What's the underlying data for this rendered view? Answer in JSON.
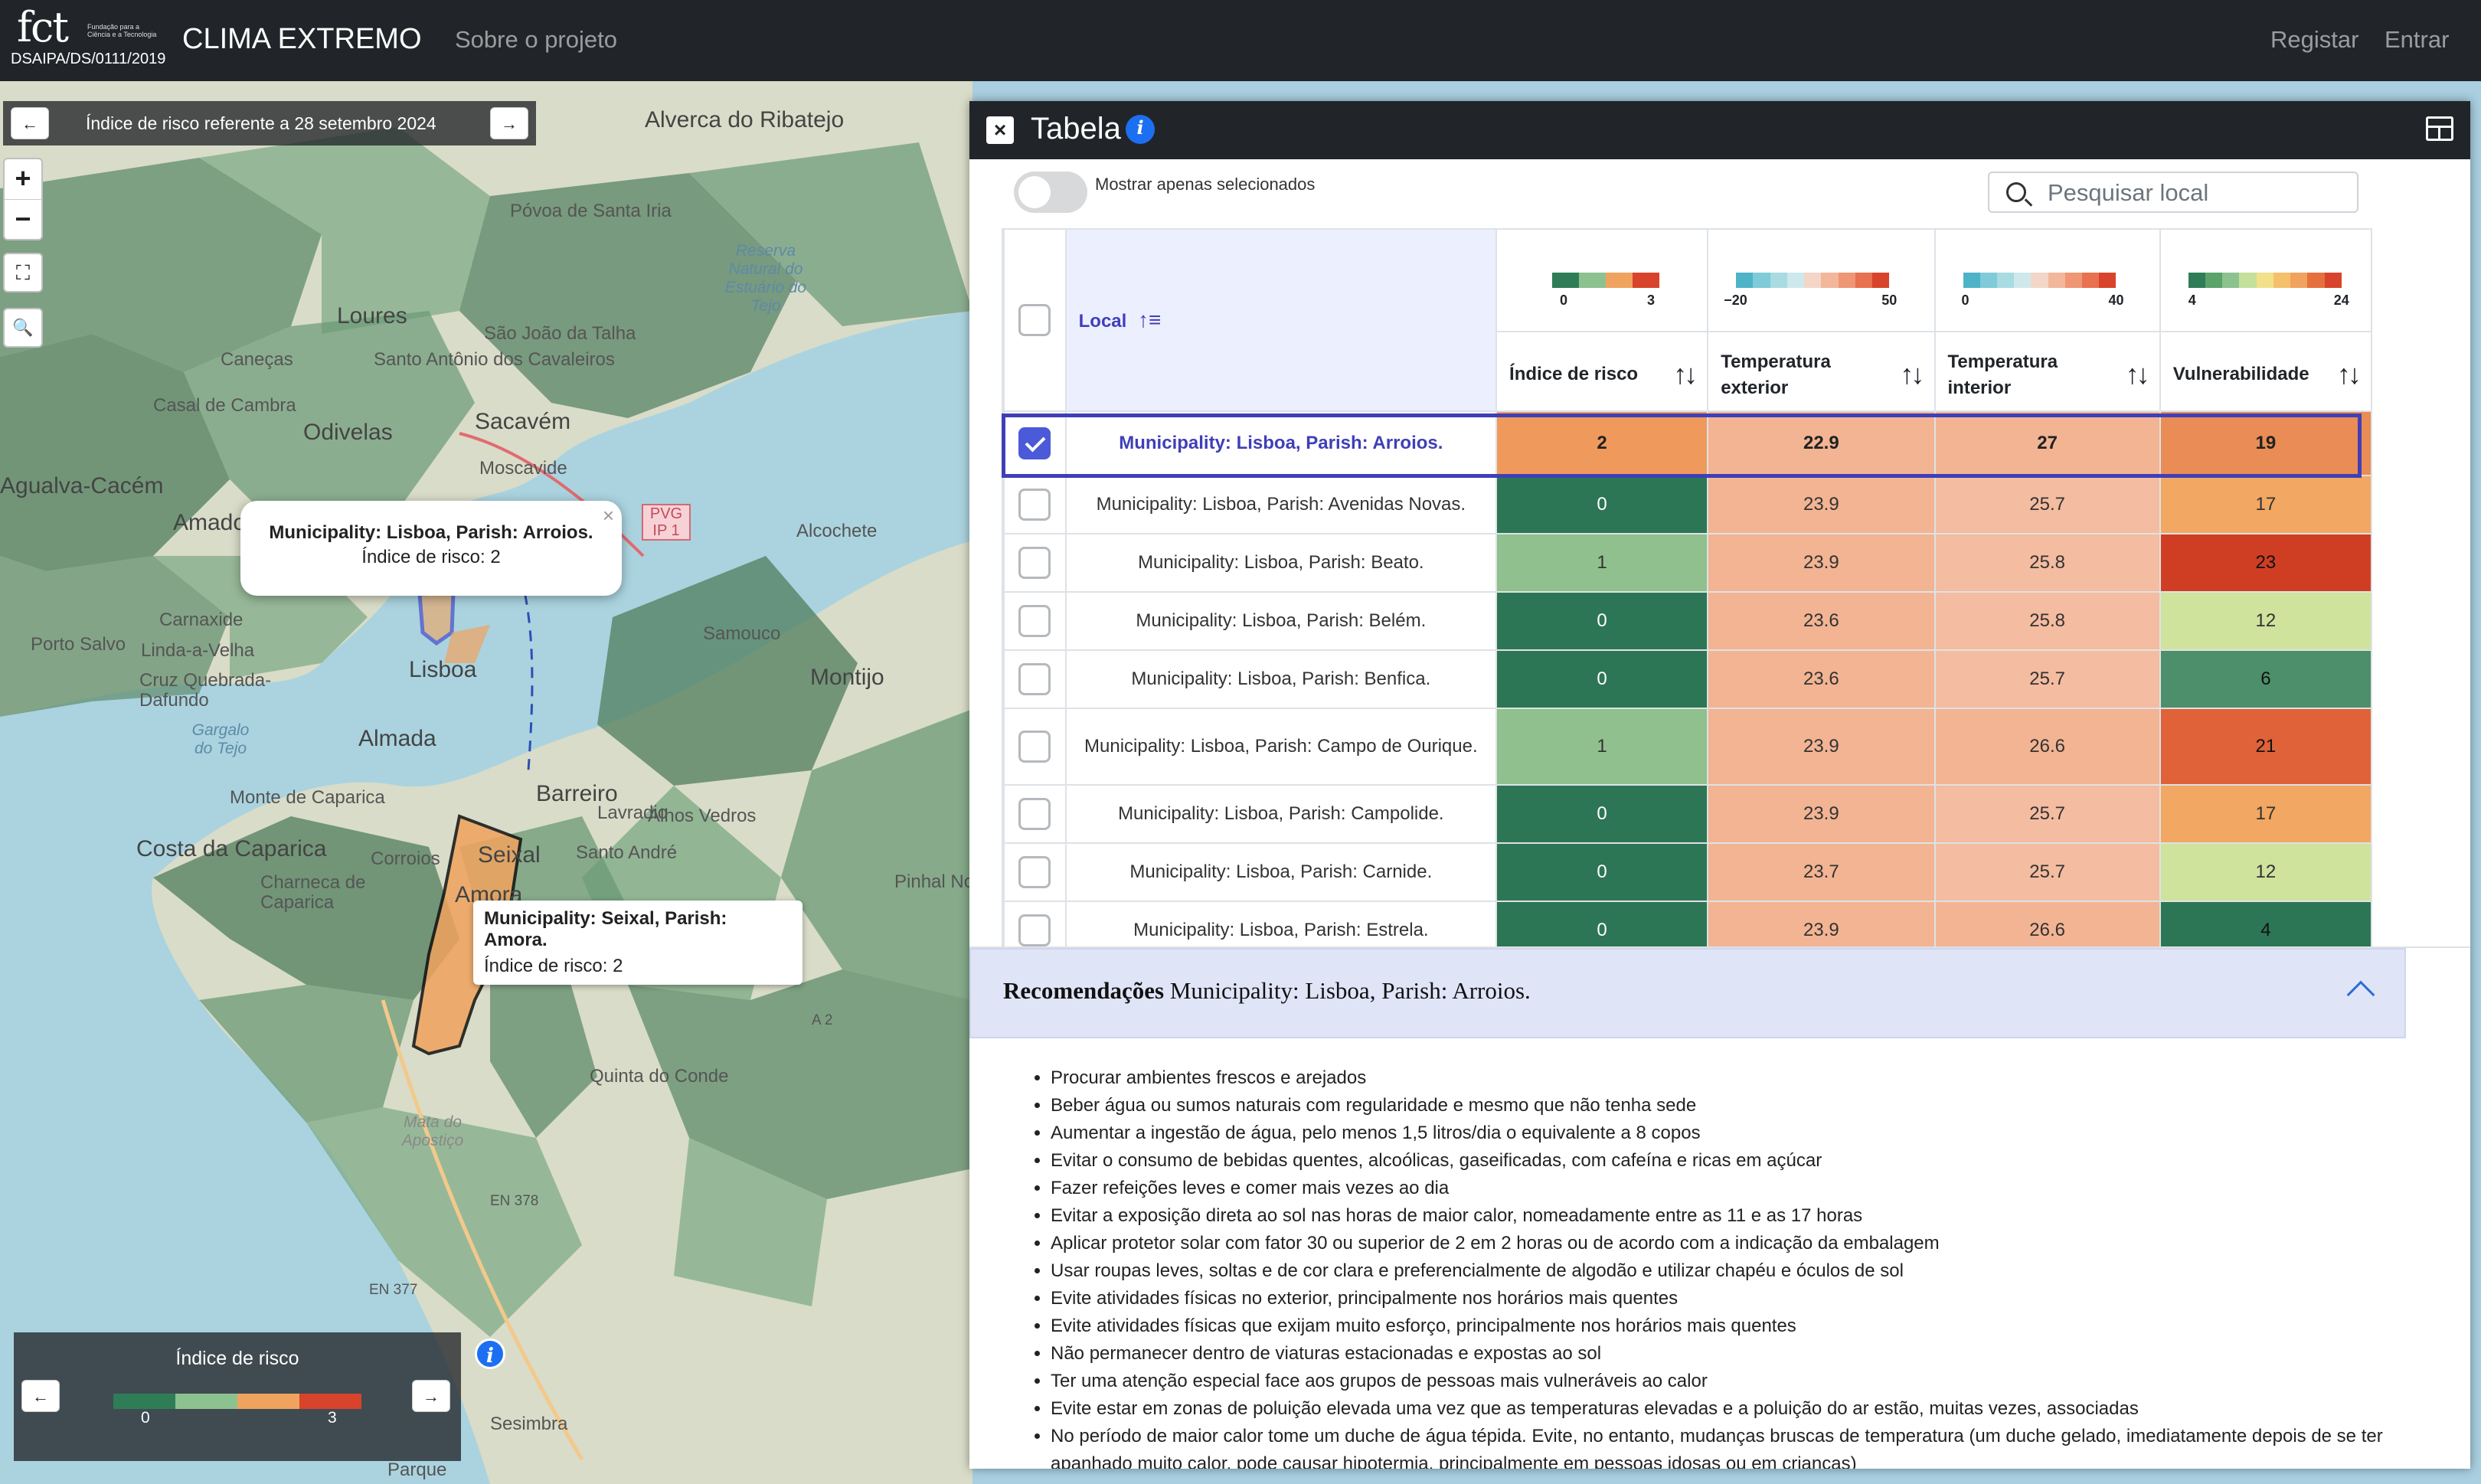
{
  "navbar": {
    "logo_text": "fct",
    "logo_subtext": "Fundação para a Ciência e a Tecnologia",
    "project_code": "DSAIPA/DS/0111/2019",
    "brand": "CLIMA EXTREMO",
    "about_link": "Sobre o projeto",
    "register_link": "Registar",
    "login_link": "Entrar"
  },
  "map": {
    "date_label": "Índice de risco referente a 28 setembro 2024",
    "zoom_in": "+",
    "zoom_out": "−",
    "place_labels": [
      "Alverca do Ribatejo",
      "Póvoa de Santa Iria",
      "Loures",
      "São João da Talha",
      "Santo Antônio dos Cavaleiros",
      "Caneças",
      "Casal de Cambra",
      "Odivelas",
      "Sacavém",
      "Moscavide",
      "Agualva-Cacém",
      "Amadora",
      "Carnaxide",
      "Porto Salvo",
      "Linda-a-Velha",
      "Cruz Quebrada-Dafundo",
      "Lisboa",
      "Almada",
      "Montijo",
      "Samouco",
      "Alcochete",
      "Barreiro",
      "Lavradio",
      "Alhos Vedros",
      "Santo André",
      "Seixal",
      "Amora",
      "Corroios",
      "Costa da Caparica",
      "Monte de Caparica",
      "Charneca de Caparica",
      "Pinhal Novo",
      "Quinta do Conde",
      "Sesimbra",
      "Parque",
      "Reserva Natural do Estuário do Tejo",
      "Gargalo do Tejo",
      "Mata do Apostiço",
      "EN 378",
      "EN 377",
      "A 2"
    ],
    "road_badge": "PVG IP 1",
    "popup": {
      "title": "Municipality: Lisboa, Parish: Arroios.",
      "risk": "Índice de risco: 2",
      "close": "×"
    },
    "tooltip": {
      "title": "Municipality: Seixal, Parish: Amora.",
      "risk": "Índice de risco: 2"
    },
    "legend": {
      "title": "Índice de risco",
      "min": "0",
      "max": "3",
      "colors": [
        "#2e7d57",
        "#8cc28f",
        "#f0a35e",
        "#d8432b"
      ]
    }
  },
  "panel": {
    "title": "Tabela",
    "toggle_label": "Mostrar apenas selecionados",
    "search_placeholder": "Pesquisar local",
    "columns": [
      {
        "label": "Local",
        "scale_min": "",
        "scale_max": ""
      },
      {
        "label": "Índice de risco",
        "scale_min": "0",
        "scale_max": "3"
      },
      {
        "label": "Temperatura exterior",
        "scale_min": "−20",
        "scale_max": "50"
      },
      {
        "label": "Temperatura interior",
        "scale_min": "0",
        "scale_max": "40"
      },
      {
        "label": "Vulnerabilidade",
        "scale_min": "4",
        "scale_max": "24"
      }
    ],
    "scales": {
      "risk": [
        "#2e7d57",
        "#8cc28f",
        "#f0a35e",
        "#d8432b"
      ],
      "temp_ext": [
        "#4fb3c8",
        "#7fcbd8",
        "#a9dbe3",
        "#cfe8ec",
        "#f3d6c8",
        "#f2b79a",
        "#ef9674",
        "#e8714f",
        "#d8432b"
      ],
      "temp_int": [
        "#4fb3c8",
        "#7fcbd8",
        "#a9dbe3",
        "#cfe8ec",
        "#f3d6c8",
        "#f2b79a",
        "#ef9674",
        "#e8714f",
        "#d8432b"
      ],
      "vuln": [
        "#2e7d57",
        "#5aa36a",
        "#8cc28f",
        "#c4e09a",
        "#f2e08a",
        "#f5c06c",
        "#f0a35e",
        "#e5703e",
        "#d8432b"
      ]
    },
    "rows": [
      {
        "name": "Municipality: Lisboa, Parish: Arroios.",
        "risk": "2",
        "text": "22.9",
        "tint": "27",
        "vuln": "19",
        "selected": true,
        "c_risk": "#ef9a5c",
        "c_text": "#f2b493",
        "c_tint": "#f2b493",
        "c_vuln": "#e98c55"
      },
      {
        "name": "Municipality: Lisboa, Parish: Avenidas Novas.",
        "risk": "0",
        "text": "23.9",
        "tint": "25.7",
        "vuln": "17",
        "selected": false,
        "c_risk": "#2d7655",
        "c_text": "#f2b493",
        "c_tint": "#f4bca0",
        "c_vuln": "#f2a762"
      },
      {
        "name": "Municipality: Lisboa, Parish: Beato.",
        "risk": "1",
        "text": "23.9",
        "tint": "25.8",
        "vuln": "23",
        "selected": false,
        "c_risk": "#8fc08d",
        "c_text": "#f2b493",
        "c_tint": "#f4bca0",
        "c_vuln": "#cf3e23"
      },
      {
        "name": "Municipality: Lisboa, Parish: Belém.",
        "risk": "0",
        "text": "23.6",
        "tint": "25.8",
        "vuln": "12",
        "selected": false,
        "c_risk": "#2d7655",
        "c_text": "#f2b493",
        "c_tint": "#f4bca0",
        "c_vuln": "#cfe39d"
      },
      {
        "name": "Municipality: Lisboa, Parish: Benfica.",
        "risk": "0",
        "text": "23.6",
        "tint": "25.7",
        "vuln": "6",
        "selected": false,
        "c_risk": "#2d7655",
        "c_text": "#f2b493",
        "c_tint": "#f4bca0",
        "c_vuln": "#4c8f6a"
      },
      {
        "name": "Municipality: Lisboa, Parish: Campo de Ourique.",
        "risk": "1",
        "text": "23.9",
        "tint": "26.6",
        "vuln": "21",
        "selected": false,
        "c_risk": "#8fc08d",
        "c_text": "#f2b493",
        "c_tint": "#f2b493",
        "c_vuln": "#df6238"
      },
      {
        "name": "Municipality: Lisboa, Parish: Campolide.",
        "risk": "0",
        "text": "23.9",
        "tint": "25.7",
        "vuln": "17",
        "selected": false,
        "c_risk": "#2d7655",
        "c_text": "#f2b493",
        "c_tint": "#f4bca0",
        "c_vuln": "#f2a762"
      },
      {
        "name": "Municipality: Lisboa, Parish: Carnide.",
        "risk": "0",
        "text": "23.7",
        "tint": "25.7",
        "vuln": "12",
        "selected": false,
        "c_risk": "#2d7655",
        "c_text": "#f2b493",
        "c_tint": "#f4bca0",
        "c_vuln": "#cfe39d"
      },
      {
        "name": "Municipality: Lisboa, Parish: Estrela.",
        "risk": "0",
        "text": "23.9",
        "tint": "26.6",
        "vuln": "4",
        "selected": false,
        "c_risk": "#2d7655",
        "c_text": "#f2b493",
        "c_tint": "#f2b493",
        "c_vuln": "#2d7655"
      }
    ]
  },
  "recommendations": {
    "heading": "Recomendações",
    "place": "Municipality: Lisboa, Parish: Arroios.",
    "items": [
      "Procurar ambientes frescos e arejados",
      "Beber água ou sumos naturais com regularidade e mesmo que não tenha sede",
      "Aumentar a ingestão de água, pelo menos 1,5 litros/dia o equivalente a 8 copos",
      "Evitar o consumo de bebidas quentes, alcoólicas, gaseificadas, com cafeína e ricas em açúcar",
      "Fazer refeições leves e comer mais vezes ao dia",
      "Evitar a exposição direta ao sol nas horas de maior calor, nomeadamente entre as 11 e as 17 horas",
      "Aplicar protetor solar com fator 30 ou superior de 2 em 2 horas ou de acordo com a indicação da embalagem",
      "Usar roupas leves, soltas e de cor clara e preferencialmente de algodão e utilizar chapéu e óculos de sol",
      "Evite atividades físicas no exterior, principalmente nos horários mais quentes",
      "Evite atividades físicas que exijam muito esforço, principalmente nos horários mais quentes",
      "Não permanecer dentro de viaturas estacionadas e expostas ao sol",
      "Ter uma atenção especial face aos grupos de pessoas mais vulneráveis ao calor",
      "Evite estar em zonas de poluição elevada uma vez que as temperaturas elevadas e a poluição do ar estão, muitas vezes, associadas",
      "No período de maior calor tome um duche de água tépida. Evite, no entanto, mudanças bruscas de temperatura (um duche gelado, imediatamente depois de se ter apanhado muito calor, pode causar hipotermia, principalmente em pessoas idosas ou em crianças)"
    ]
  }
}
